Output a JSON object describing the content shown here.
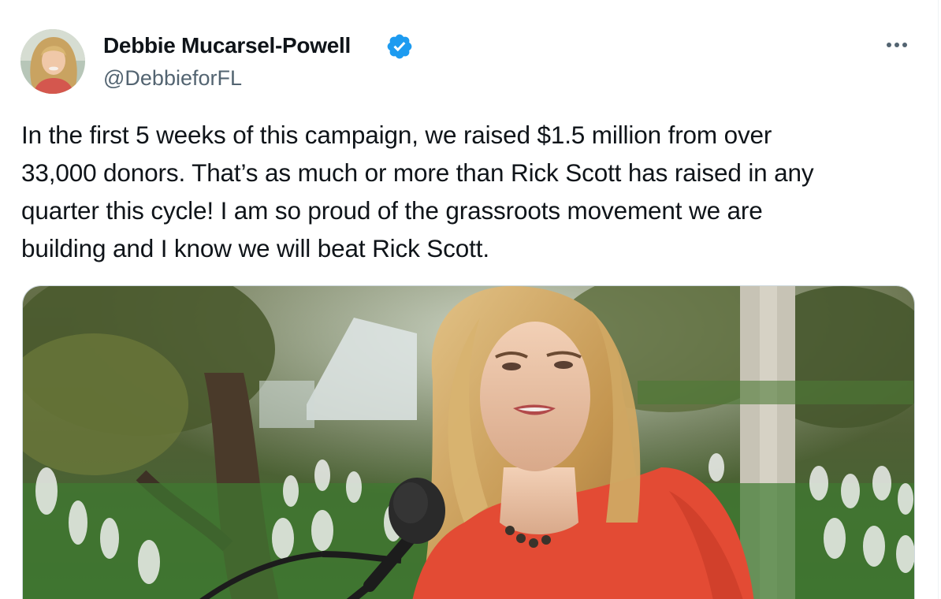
{
  "author": {
    "display_name": "Debbie Mucarsel-Powell",
    "handle": "@DebbieforFL",
    "verified": true
  },
  "tweet": {
    "text": "In the first 5 weeks of this campaign, we raised $1.5 million from over\n33,000 donors. That’s as much or more than Rick Scott has raised in any\nquarter this cycle! I am so proud of the grassroots movement we are\nbuilding and I know we will beat Rick Scott."
  },
  "icons": {
    "verified": "verified-badge-icon",
    "more": "more-options-icon"
  },
  "colors": {
    "text": "#0f1419",
    "secondary_text": "#536471",
    "verified_blue": "#1d9bf0",
    "media_border": "#cfd9de"
  }
}
